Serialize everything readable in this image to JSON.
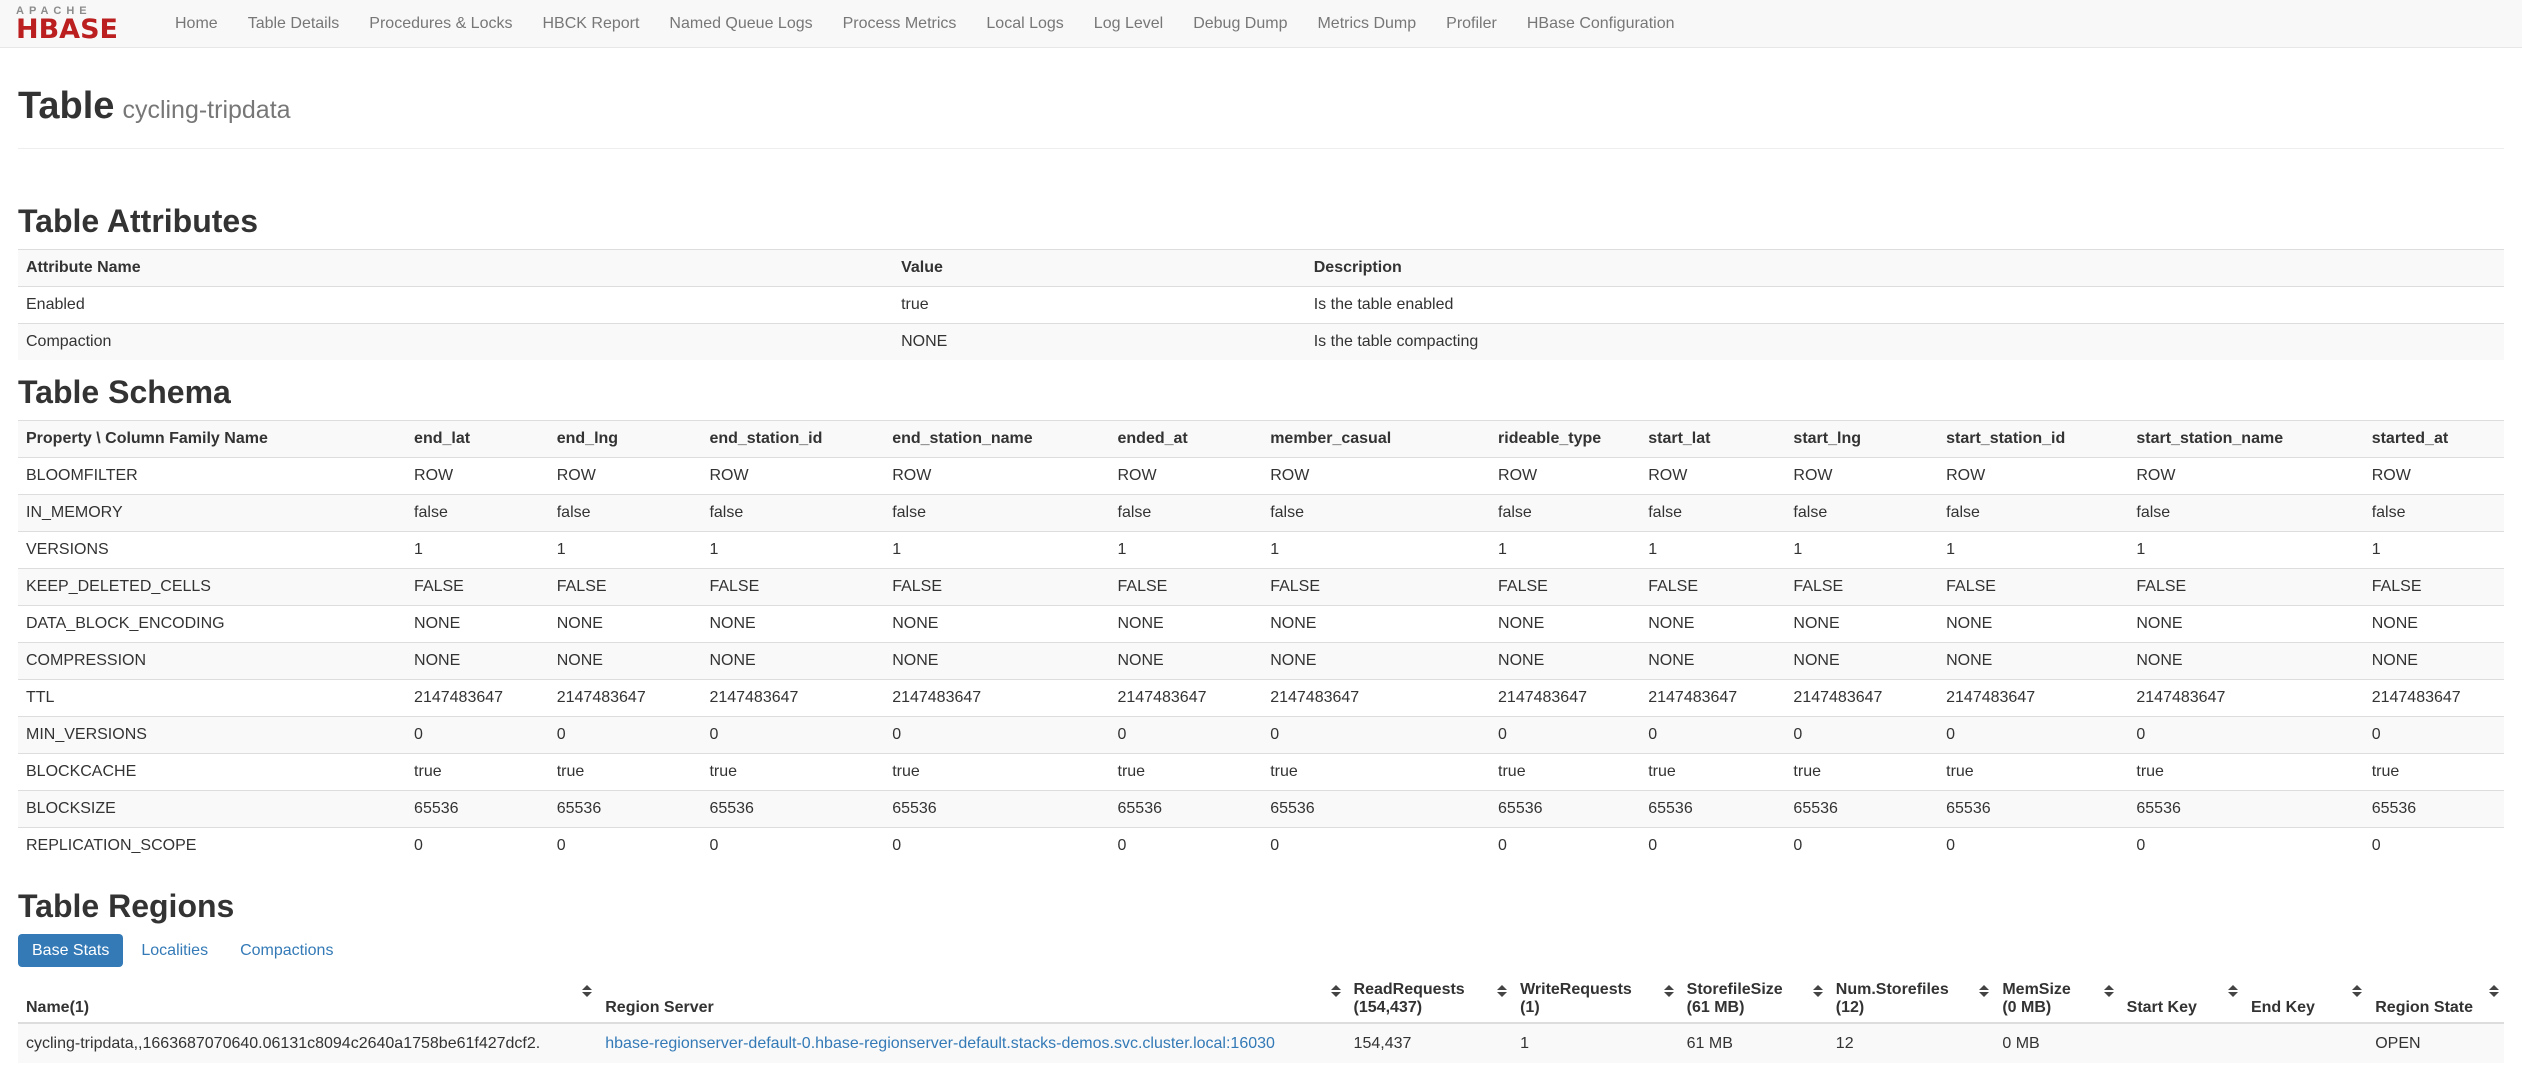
{
  "colors": {
    "brand_red": "#bb1f1f",
    "brand_gray": "#8c8c8c",
    "navbar_bg": "#f8f8f8",
    "link_blue": "#337ab7",
    "active_tab_bg": "#337ab7",
    "stripe": "#f9f9f9",
    "border": "#dddddd",
    "text": "#333333",
    "muted": "#777777"
  },
  "navbar": {
    "logo_top": "APACHE",
    "logo_bottom": "HBASE",
    "items": [
      "Home",
      "Table Details",
      "Procedures & Locks",
      "HBCK Report",
      "Named Queue Logs",
      "Process Metrics",
      "Local Logs",
      "Log Level",
      "Debug Dump",
      "Metrics Dump",
      "Profiler",
      "HBase Configuration"
    ]
  },
  "page": {
    "title": "Table",
    "subtitle": "cycling-tripdata"
  },
  "attributes": {
    "heading": "Table Attributes",
    "columns": [
      "Attribute Name",
      "Value",
      "Description"
    ],
    "col_widths": [
      "35.2%",
      "16.6%",
      "48.2%"
    ],
    "rows": [
      [
        "Enabled",
        "true",
        "Is the table enabled"
      ],
      [
        "Compaction",
        "NONE",
        "Is the table compacting"
      ]
    ]
  },
  "schema": {
    "heading": "Table Schema",
    "corner_header": "Property \\ Column Family Name",
    "corner_width": "15.5%",
    "family_widths": [
      "5.7%",
      "6.1%",
      "7.3%",
      "9.0%",
      "6.1%",
      "9.1%",
      "6.0%",
      "5.8%",
      "6.1%",
      "7.6%",
      "9.4%",
      "5.6%"
    ],
    "families": [
      "end_lat",
      "end_lng",
      "end_station_id",
      "end_station_name",
      "ended_at",
      "member_casual",
      "rideable_type",
      "start_lat",
      "start_lng",
      "start_station_id",
      "start_station_name",
      "started_at"
    ],
    "rows": [
      {
        "property": "BLOOMFILTER",
        "value": "ROW"
      },
      {
        "property": "IN_MEMORY",
        "value": "false"
      },
      {
        "property": "VERSIONS",
        "value": "1"
      },
      {
        "property": "KEEP_DELETED_CELLS",
        "value": "FALSE"
      },
      {
        "property": "DATA_BLOCK_ENCODING",
        "value": "NONE"
      },
      {
        "property": "COMPRESSION",
        "value": "NONE"
      },
      {
        "property": "TTL",
        "value": "2147483647"
      },
      {
        "property": "MIN_VERSIONS",
        "value": "0"
      },
      {
        "property": "BLOCKCACHE",
        "value": "true"
      },
      {
        "property": "BLOCKSIZE",
        "value": "65536"
      },
      {
        "property": "REPLICATION_SCOPE",
        "value": "0"
      }
    ]
  },
  "regions": {
    "heading": "Table Regions",
    "tabs": [
      {
        "label": "Base Stats",
        "active": true
      },
      {
        "label": "Localities",
        "active": false
      },
      {
        "label": "Compactions",
        "active": false
      }
    ],
    "columns": [
      {
        "key": "name",
        "lines": [
          "Name(1)"
        ],
        "width": "23.3%"
      },
      {
        "key": "region_server",
        "lines": [
          "Region Server"
        ],
        "width": "30.1%"
      },
      {
        "key": "read_requests",
        "lines": [
          "ReadRequests",
          "(154,437)"
        ],
        "width": "6.7%"
      },
      {
        "key": "write_requests",
        "lines": [
          "WriteRequests",
          "(1)"
        ],
        "width": "6.7%"
      },
      {
        "key": "storefile_size",
        "lines": [
          "StorefileSize",
          "(61 MB)"
        ],
        "width": "6.0%"
      },
      {
        "key": "num_storefiles",
        "lines": [
          "Num.Storefiles",
          "(12)"
        ],
        "width": "6.7%"
      },
      {
        "key": "mem_size",
        "lines": [
          "MemSize",
          "(0 MB)"
        ],
        "width": "5.0%"
      },
      {
        "key": "start_key",
        "lines": [
          "Start Key"
        ],
        "width": "5.0%"
      },
      {
        "key": "end_key",
        "lines": [
          "End Key"
        ],
        "width": "5.0%"
      },
      {
        "key": "region_state",
        "lines": [
          "Region State"
        ],
        "width": "5.5%"
      }
    ],
    "row": {
      "name": "cycling-tripdata,,1663687070640.06131c8094c2640a1758be61f427dcf2.",
      "region_server": "hbase-regionserver-default-0.hbase-regionserver-default.stacks-demos.svc.cluster.local:16030",
      "read_requests": "154,437",
      "write_requests": "1",
      "storefile_size": "61 MB",
      "num_storefiles": "12",
      "mem_size": "0 MB",
      "start_key": "",
      "end_key": "",
      "region_state": "OPEN"
    }
  }
}
